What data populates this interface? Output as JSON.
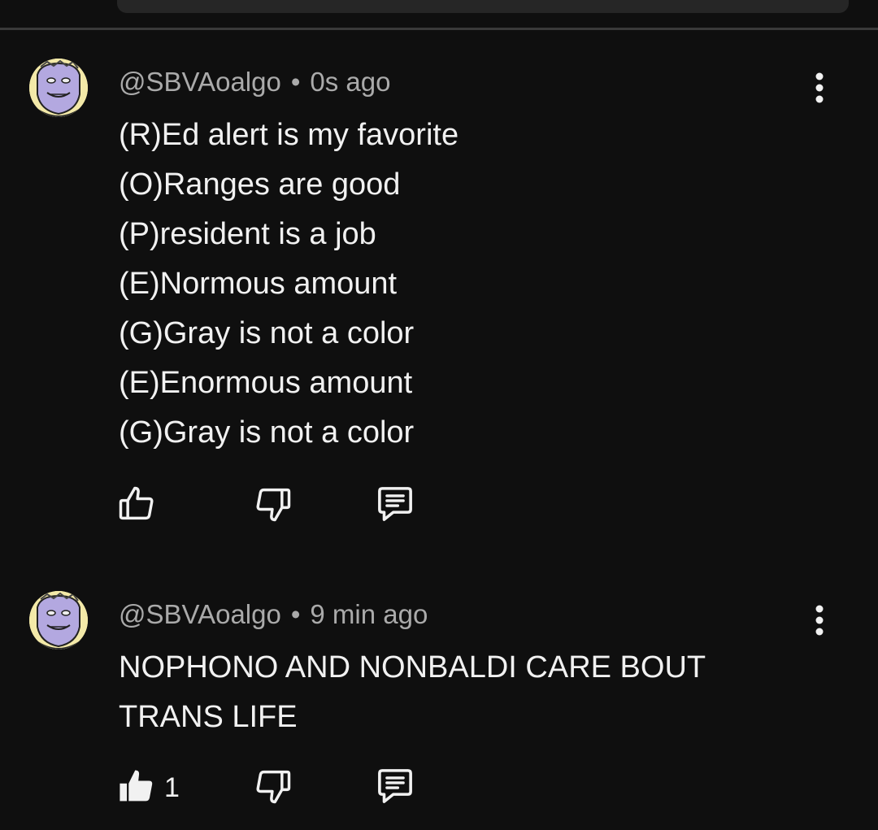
{
  "comments": [
    {
      "author": "@SBVAoalgo",
      "separator": "•",
      "time": "0s ago",
      "lines": [
        "(R)Ed alert is my favorite",
        "(O)Ranges are good",
        "(P)resident is a job",
        "(E)Normous amount",
        "(G)Gray is not a color",
        "(E)Enormous amount",
        "(G)Gray is not a color"
      ],
      "likes": "",
      "liked": false,
      "icons": {
        "like": "thumbs-up-outline-icon",
        "dislike": "thumbs-down-outline-icon",
        "reply": "reply-comment-icon",
        "more": "more-vert-icon"
      }
    },
    {
      "author": "@SBVAoalgo",
      "separator": "•",
      "time": "9 min ago",
      "lines": [
        "NOPHONO AND NONBALDI CARE BOUT",
        "TRANS LIFE"
      ],
      "likes": "1",
      "liked": true,
      "icons": {
        "like": "thumbs-up-filled-icon",
        "dislike": "thumbs-down-outline-icon",
        "reply": "reply-comment-icon",
        "more": "more-vert-icon"
      }
    }
  ],
  "colors": {
    "background": "#0f0f0f",
    "primary_text": "#f1f1f1",
    "secondary_text": "#aaaaaa",
    "avatar_face": "#b3a8e0",
    "avatar_bg": "#f3e9a8"
  }
}
